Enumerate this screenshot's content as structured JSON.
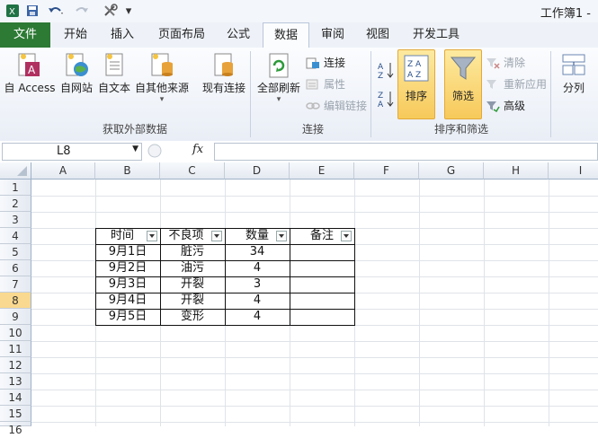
{
  "window_title": "工作簿1 -",
  "qat": {
    "save_icon": "save-icon",
    "undo_icon": "undo-icon",
    "redo_icon": "redo-icon",
    "customize": "▾"
  },
  "tabs": [
    {
      "label": "文件"
    },
    {
      "label": "开始"
    },
    {
      "label": "插入"
    },
    {
      "label": "页面布局"
    },
    {
      "label": "公式"
    },
    {
      "label": "数据"
    },
    {
      "label": "审阅"
    },
    {
      "label": "视图"
    },
    {
      "label": "开发工具"
    }
  ],
  "ribbon": {
    "get_external": {
      "group_label": "获取外部数据",
      "access": "自 Access",
      "web": "自网站",
      "text": "自文本",
      "other": "自其他来源",
      "existing": "现有连接"
    },
    "connections": {
      "group_label": "连接",
      "refresh_all": "全部刷新",
      "connections": "连接",
      "properties": "属性",
      "edit_links": "编辑链接"
    },
    "sort_filter": {
      "group_label": "排序和筛选",
      "sort": "排序",
      "filter": "筛选",
      "clear": "清除",
      "reapply": "重新应用",
      "advanced": "高级"
    },
    "data_tools": {
      "text_to_columns": "分列"
    }
  },
  "formula_bar": {
    "name_box": "L8",
    "fx": "fx",
    "formula": ""
  },
  "columns": [
    "A",
    "B",
    "C",
    "D",
    "E",
    "F",
    "G",
    "H",
    "I"
  ],
  "rows": [
    "1",
    "2",
    "3",
    "4",
    "5",
    "6",
    "7",
    "8",
    "9",
    "10",
    "11",
    "12",
    "13",
    "14",
    "15",
    "16"
  ],
  "selected_row": "8",
  "table": {
    "headers": [
      "时间",
      "不良项",
      "数量",
      "备注"
    ],
    "rows": [
      [
        "9月1日",
        "脏污",
        "34",
        ""
      ],
      [
        "9月2日",
        "油污",
        "4",
        ""
      ],
      [
        "9月3日",
        "开裂",
        "3",
        ""
      ],
      [
        "9月4日",
        "开裂",
        "4",
        ""
      ],
      [
        "9月5日",
        "变形",
        "4",
        ""
      ]
    ]
  },
  "colors": {
    "file_tab": "#2d7a34",
    "highlight": "#f7c95a",
    "accent": "#2a4f8a"
  }
}
